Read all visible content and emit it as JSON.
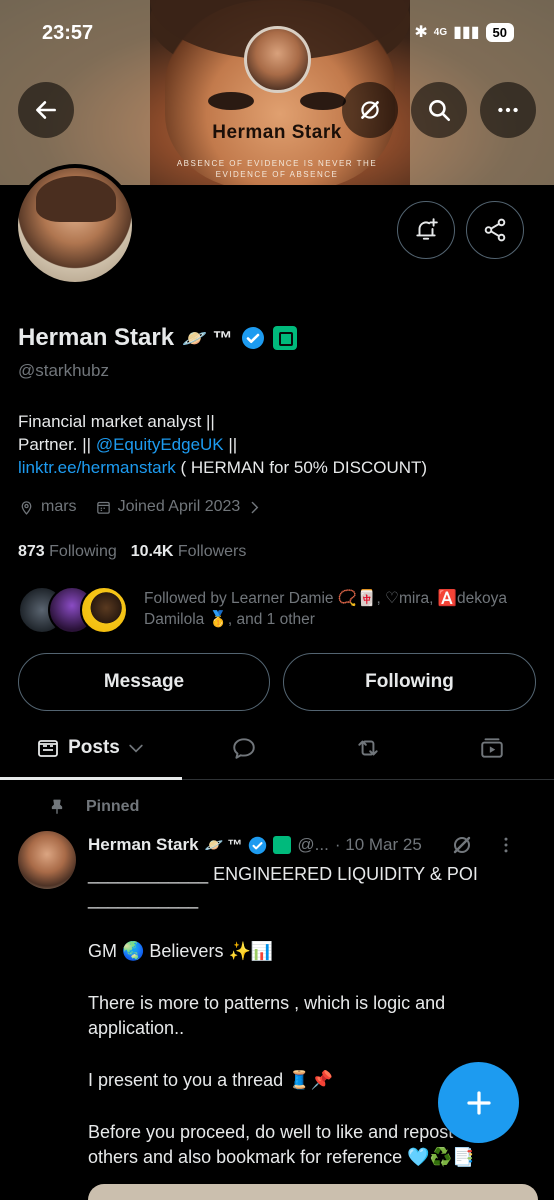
{
  "status_bar": {
    "time": "23:57",
    "network": "4G",
    "battery": "50"
  },
  "banner": {
    "title": "Herman Stark",
    "subtitle": "ABSENCE OF EVIDENCE IS NEVER THE EVIDENCE OF ABSENCE"
  },
  "profile": {
    "name": "Herman Stark",
    "name_emoji": "🪐 ™",
    "handle": "@starkhubz",
    "bio_line1": "Financial market analyst ||",
    "bio_line2_prefix": "Partner. || ",
    "bio_mention": "@EquityEdgeUK",
    "bio_line2_suffix": " ||",
    "bio_link": "linktr.ee/hermanstark",
    "bio_link_suffix": " ( HERMAN for 50% DISCOUNT)",
    "location": "mars",
    "joined": "Joined April 2023",
    "following_count": "873",
    "following_label": "Following",
    "followers_count": "10.4K",
    "followers_label": "Followers",
    "followed_by": "Followed by Learner Damie 📿🀄, ♡mira, 🅰️dekoya Damilola 🥇, and 1 other"
  },
  "actions": {
    "message": "Message",
    "following": "Following"
  },
  "tabs": {
    "posts": "Posts"
  },
  "post": {
    "pinned_label": "Pinned",
    "author": "Herman Stark",
    "author_emoji": "🪐 ™",
    "handle": "@...",
    "date": "· 10 Mar 25",
    "line1": "____________ ENGINEERED LIQUIDITY & POI ___________",
    "line2": "GM 🌏 Believers ✨📊",
    "line3": "There is more to patterns , which is logic and application..",
    "line4": "I present to you a thread 🧵📌",
    "line5": "Before you proceed, do well to like and repost for others and also bookmark for reference 🩵♻️📑"
  },
  "colors": {
    "accent": "#1d9bf0",
    "background": "#000000",
    "muted": "#71767b",
    "border": "#536471",
    "affiliate": "#00ba7c"
  },
  "icons": [
    "back-arrow-icon",
    "grok-icon",
    "search-icon",
    "more-icon",
    "bell-plus-icon",
    "share-icon",
    "location-icon",
    "calendar-icon",
    "chevron-right-icon",
    "posts-icon",
    "chevron-down-icon",
    "reply-icon",
    "repost-icon",
    "media-icon",
    "pin-icon",
    "verified-icon",
    "compose-plus-icon"
  ]
}
